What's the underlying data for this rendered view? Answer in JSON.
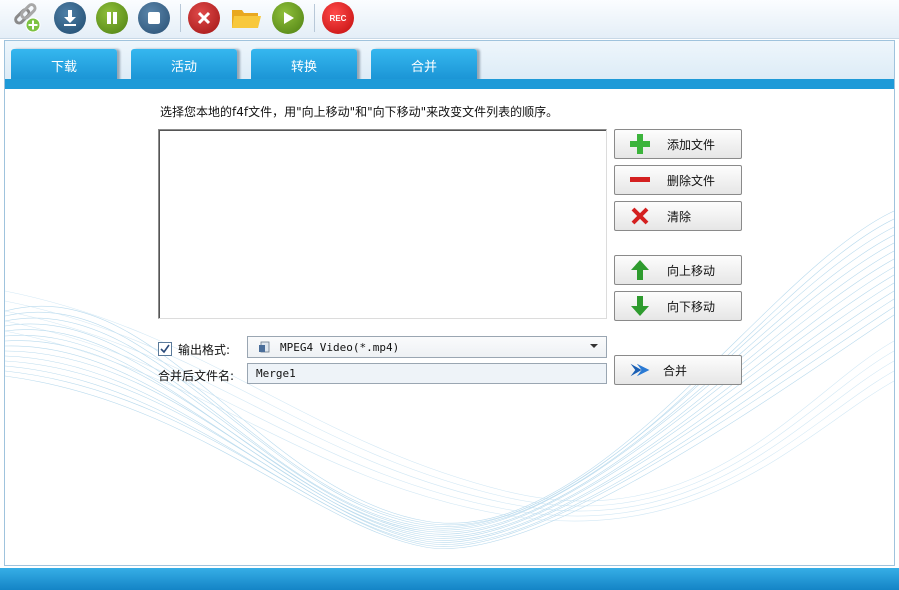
{
  "toolbar": {
    "buttons": [
      {
        "name": "add-link-icon"
      },
      {
        "name": "download-icon"
      },
      {
        "name": "pause-icon"
      },
      {
        "name": "stop-icon"
      },
      {
        "name": "delete-icon"
      },
      {
        "name": "folder-icon"
      },
      {
        "name": "play-icon"
      },
      {
        "name": "record-icon",
        "label": "REC"
      }
    ]
  },
  "tabs": [
    {
      "label": "下载"
    },
    {
      "label": "活动"
    },
    {
      "label": "转换"
    },
    {
      "label": "合并"
    }
  ],
  "merge": {
    "instruction": "选择您本地的f4f文件，用\"向上移动\"和\"向下移动\"来改变文件列表的顺序。",
    "file_list": [],
    "buttons": {
      "add": "添加文件",
      "delete": "删除文件",
      "clear": "清除",
      "move_up": "向上移动",
      "move_down": "向下移动",
      "merge": "合并"
    },
    "output_format_label": "输出格式:",
    "output_format_checked": true,
    "output_format_value": "MPEG4 Video(*.mp4)",
    "filename_label": "合并后文件名:",
    "filename_value": "Merge1"
  },
  "colors": {
    "accent": "#1e9ad8",
    "add_green": "#3cb43c",
    "delete_red": "#d42020",
    "arrow_green": "#2e9b2e"
  }
}
